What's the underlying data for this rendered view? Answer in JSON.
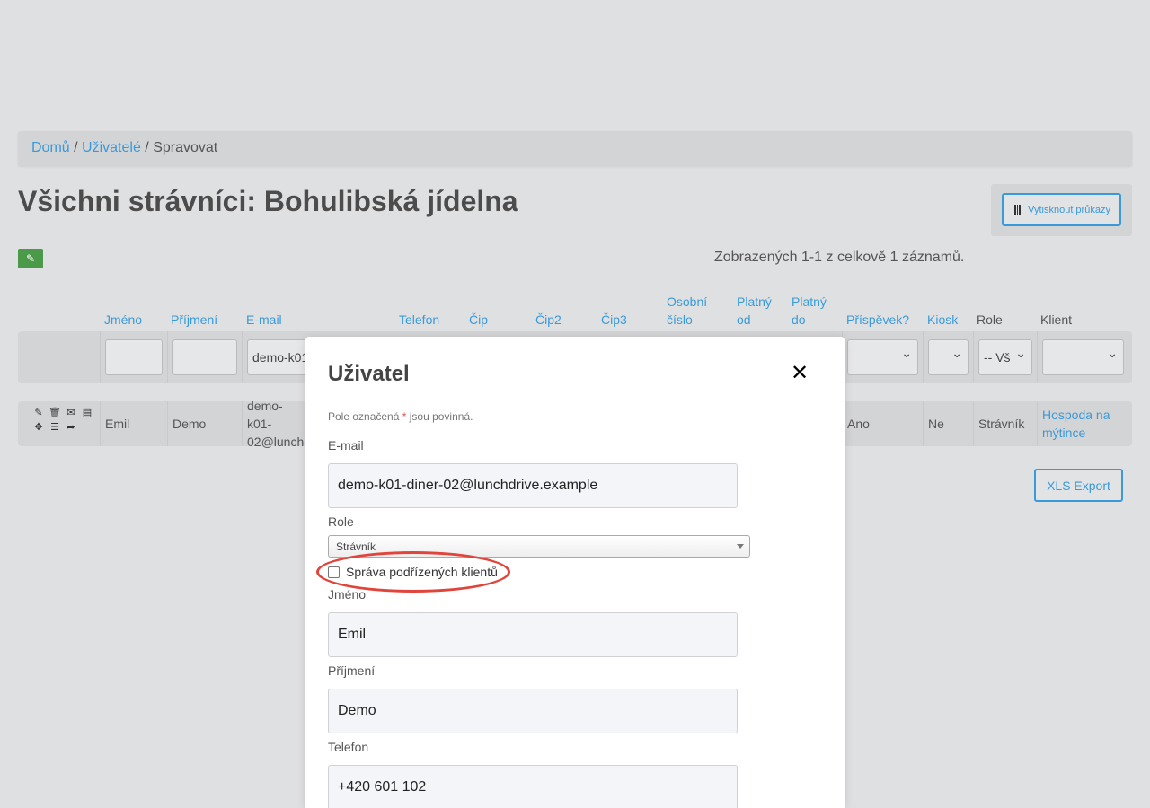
{
  "breadcrumb": {
    "home": "Domů",
    "sep": " / ",
    "users": "Uživatelé",
    "current": "Spravovat"
  },
  "page": {
    "title": "Všichni strávníci: Bohulibská jídelna",
    "summary": "Zobrazených 1-1 z celkově 1 záznamů."
  },
  "actions": {
    "print_cards": "Vytisknout průkazy",
    "xls_export": "XLS Export",
    "edit_icon": "pencil-icon"
  },
  "table": {
    "headers": {
      "jmeno": "Jméno",
      "prijmeni": "Příjmení",
      "email": "E-mail",
      "telefon": "Telefon",
      "cip": "Čip",
      "cip2": "Čip2",
      "cip3": "Čip3",
      "osobni_1": "Osobní",
      "osobni_2": "číslo",
      "platny_od_1": "Platný",
      "platny_od_2": "od",
      "platny_do_1": "Platný",
      "platny_do_2": "do",
      "prispevek": "Příspěvek?",
      "kiosk": "Kiosk",
      "role": "Role",
      "klient": "Klient"
    },
    "filters": {
      "email": "demo-k01",
      "role": "-- Vš"
    },
    "row": {
      "jmeno": "Emil",
      "prijmeni": "Demo",
      "email_1": "demo-k01-",
      "email_2": "02@lunch",
      "prispevek": "Ano",
      "kiosk": "Ne",
      "role": "Strávník",
      "klient_1": "Hospoda na",
      "klient_2": "mýtince"
    },
    "row_icons": [
      "✎",
      "🗑",
      "✉",
      "▤",
      "✥",
      "☰",
      "➦"
    ]
  },
  "modal": {
    "title": "Uživatel",
    "close": "✕",
    "required_note_pre": "Pole označená ",
    "required_star": "*",
    "required_note_post": " jsou povinná.",
    "email_label": "E-mail",
    "email_value": "demo-k01-diner-02@lunchdrive.example",
    "role_label": "Role",
    "role_value": "Strávník",
    "manage_label": "Správa podřízených klientů",
    "jmeno_label": "Jméno",
    "jmeno_value": "Emil",
    "prijmeni_label": "Příjmení",
    "prijmeni_value": "Demo",
    "telefon_label": "Telefon",
    "telefon_value": "+420 601 102"
  }
}
